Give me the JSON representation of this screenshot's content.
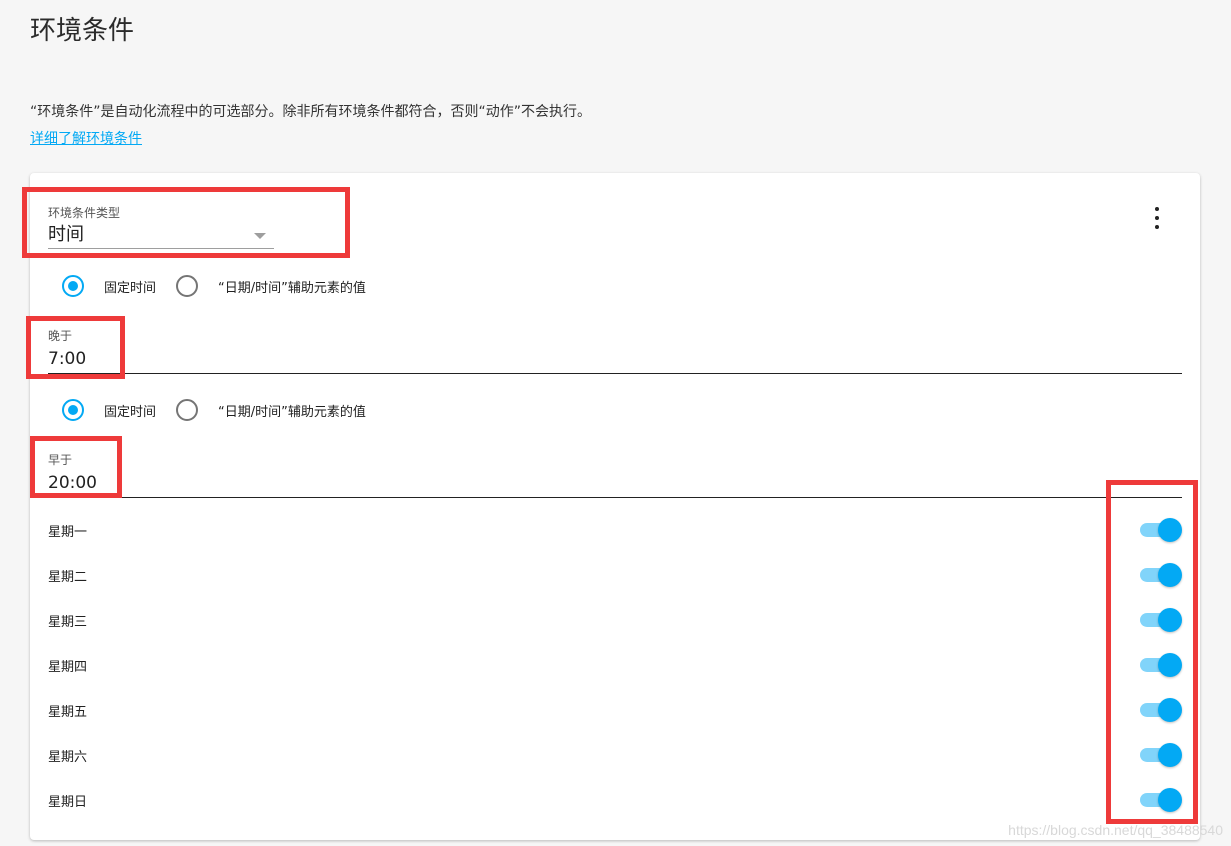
{
  "page": {
    "title": "环境条件",
    "description": "“环境条件”是自动化流程中的可选部分。除非所有环境条件都符合，否则“动作”不会执行。",
    "learn_more_link": "详细了解环境条件"
  },
  "condition": {
    "type_label": "环境条件类型",
    "type_value": "时间",
    "after": {
      "radio_fixed": "固定时间",
      "radio_helper": "“日期/时间”辅助元素的值",
      "selected": "fixed",
      "label": "晚于",
      "value": "7:00"
    },
    "before": {
      "radio_fixed": "固定时间",
      "radio_helper": "“日期/时间”辅助元素的值",
      "selected": "fixed",
      "label": "早于",
      "value": "20:00"
    },
    "weekdays": [
      {
        "label": "星期一",
        "enabled": true
      },
      {
        "label": "星期二",
        "enabled": true
      },
      {
        "label": "星期三",
        "enabled": true
      },
      {
        "label": "星期四",
        "enabled": true
      },
      {
        "label": "星期五",
        "enabled": true
      },
      {
        "label": "星期六",
        "enabled": true
      },
      {
        "label": "星期日",
        "enabled": true
      }
    ]
  },
  "icons": {
    "menu": "more-vert-icon",
    "dropdown": "chevron-down-icon"
  },
  "colors": {
    "accent": "#03a9f4",
    "accent_light": "#81d4fa",
    "highlight": "#ee3a3a"
  },
  "watermark": "https://blog.csdn.net/qq_38488540"
}
